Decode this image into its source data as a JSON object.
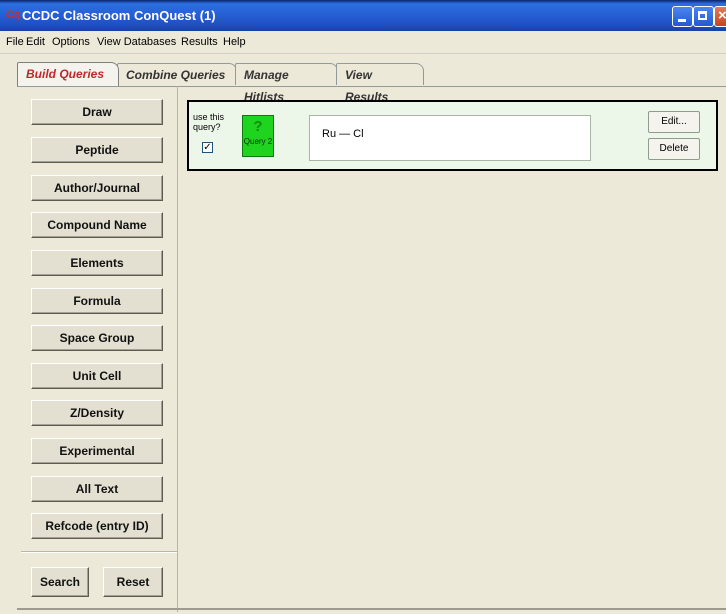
{
  "window": {
    "title": "CCDC Classroom ConQuest (1)",
    "app_icon": "Cq"
  },
  "menubar": [
    "File",
    "Edit",
    "Options",
    "View Databases",
    "Results",
    "Help"
  ],
  "tabs": [
    "Build Queries",
    "Combine Queries",
    "Manage Hitlists",
    "View Results"
  ],
  "sidebar": {
    "buttons": [
      "Draw",
      "Peptide",
      "Author/Journal",
      "Compound Name",
      "Elements",
      "Formula",
      "Space Group",
      "Unit Cell",
      "Z/Density",
      "Experimental",
      "All Text",
      "Refcode (entry ID)"
    ],
    "search_label": "Search",
    "reset_label": "Reset"
  },
  "query": {
    "use_label": "use this query?",
    "checked": true,
    "check_glyph": "✓",
    "badge_mark": "?",
    "badge_label": "Query 2",
    "text": "Ru — Cl",
    "edit_label": "Edit...",
    "delete_label": "Delete"
  },
  "colors": {
    "accent_tab": "#c0282d",
    "query_badge": "#1fd41f",
    "panel_bg": "#edf7e9"
  }
}
